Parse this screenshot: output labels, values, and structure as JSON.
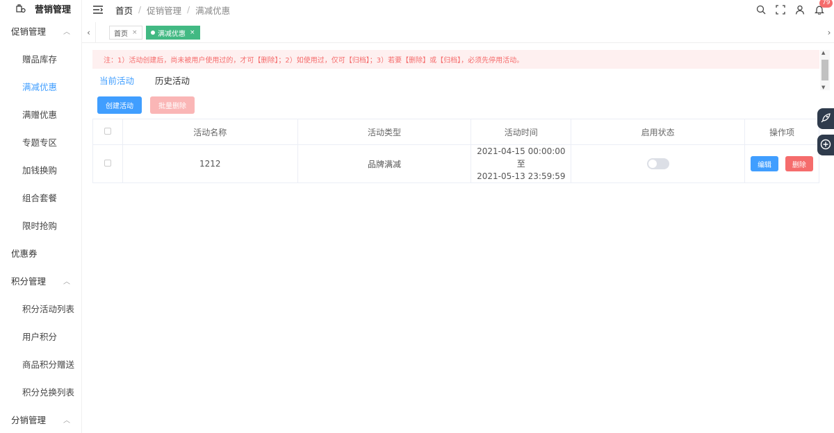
{
  "sidebar": {
    "logo": "营销管理",
    "groups": [
      {
        "label": "促销管理",
        "items": [
          "赠品库存",
          "满减优惠",
          "满赠优惠",
          "专题专区",
          "加钱换购",
          "组合套餐",
          "限时抢购"
        ]
      },
      {
        "label": "优惠券"
      },
      {
        "label": "积分管理",
        "items": [
          "积分活动列表",
          "用户积分",
          "商品积分赠送",
          "积分兑换列表"
        ]
      },
      {
        "label": "分销管理"
      }
    ]
  },
  "header": {
    "breadcrumb": [
      "首页",
      "促销管理",
      "满减优惠"
    ],
    "breadcrumb_sep": "/",
    "notification_count": "79"
  },
  "tags": [
    {
      "label": "首页",
      "close": "×"
    },
    {
      "label": "满减优惠",
      "close": "×"
    }
  ],
  "notice": "注：1）活动创建后，尚未被用户使用过的，才可【删除】；2）如使用过，仅可【归档】；3）若要【删除】或【归档】，必须先停用活动。",
  "tabs": [
    "当前活动",
    "历史活动"
  ],
  "actions": {
    "create": "创建活动",
    "batch_delete": "批量删除"
  },
  "table": {
    "columns": [
      "活动名称",
      "活动类型",
      "活动时间",
      "启用状态",
      "操作项"
    ],
    "rows": [
      {
        "name": "1212",
        "type": "品牌满减",
        "time_start": "2021-04-15 00:00:00 至",
        "time_end": "2021-05-13 23:59:59",
        "enabled": false,
        "edit": "编辑",
        "delete": "删除"
      }
    ]
  },
  "colors": {
    "primary": "#409eff",
    "danger": "#f56c6c",
    "tag_active": "#42b983",
    "notice_bg": "#fef0f0"
  }
}
